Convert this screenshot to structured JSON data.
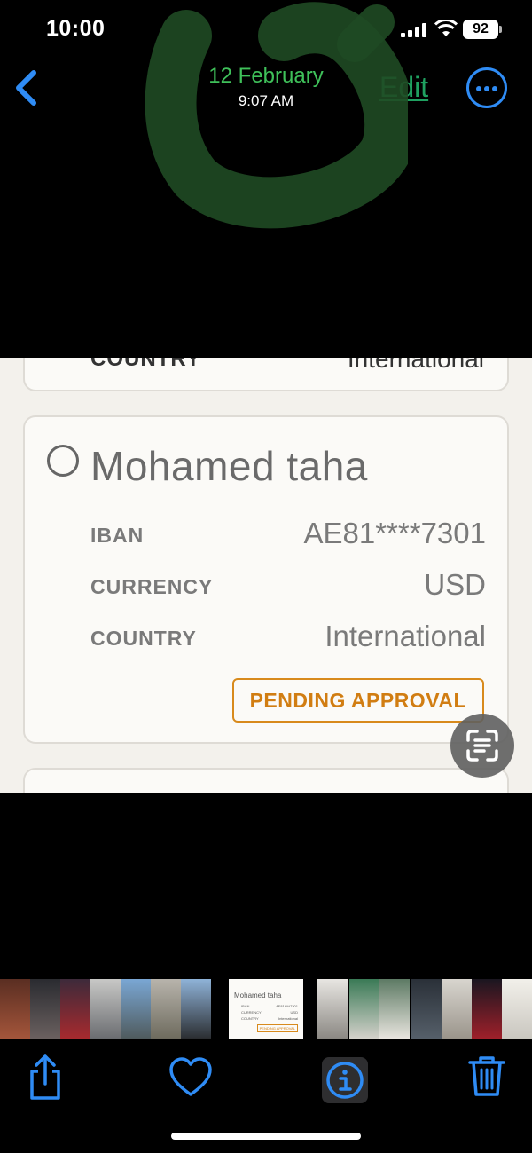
{
  "status_bar": {
    "time": "10:00",
    "battery": "92"
  },
  "nav": {
    "date": "12 February",
    "time": "9:07 AM",
    "edit_label": "Edit"
  },
  "photo": {
    "previous_card": {
      "label": "COUNTRY",
      "value": "International"
    },
    "card": {
      "name": "Mohamed taha",
      "rows": [
        {
          "label": "IBAN",
          "value": "AE81****7301"
        },
        {
          "label": "CURRENCY",
          "value": "USD"
        },
        {
          "label": "COUNTRY",
          "value": "International"
        }
      ],
      "status": "PENDING APPROVAL"
    }
  },
  "thumbnail": {
    "name": "Mohamed taha",
    "rows": [
      {
        "label": "IBAN",
        "value": "AE81****7301"
      },
      {
        "label": "CURRENCY",
        "value": "USD"
      },
      {
        "label": "COUNTRY",
        "value": "International"
      }
    ],
    "status": "PENDING APPROVAL"
  },
  "colors": {
    "accent": "#2f8cf5",
    "date_green": "#3fc15a",
    "pending": "#d17d12"
  },
  "icons": [
    "back-chevron-icon",
    "more-icon",
    "live-text-icon",
    "share-icon",
    "heart-icon",
    "info-icon",
    "trash-icon"
  ]
}
